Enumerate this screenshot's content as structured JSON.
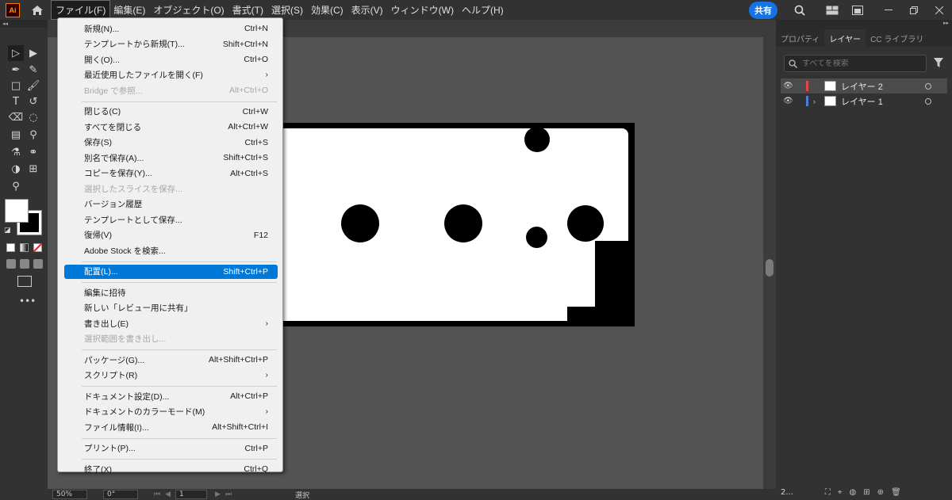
{
  "app": {
    "logo_text": "Ai",
    "menus": [
      "ファイル(F)",
      "編集(E)",
      "オブジェクト(O)",
      "書式(T)",
      "選択(S)",
      "効果(C)",
      "表示(V)",
      "ウィンドウ(W)",
      "ヘルプ(H)"
    ],
    "share_label": "共有"
  },
  "file_menu": {
    "items": [
      {
        "label": "新規(N)...",
        "shortcut": "Ctrl+N"
      },
      {
        "label": "テンプレートから新規(T)...",
        "shortcut": "Shift+Ctrl+N"
      },
      {
        "label": "開く(O)...",
        "shortcut": "Ctrl+O"
      },
      {
        "label": "最近使用したファイルを開く(F)",
        "shortcut": "›"
      },
      {
        "label": "Bridge で参照...",
        "shortcut": "Alt+Ctrl+O"
      },
      {
        "label": "閉じる(C)",
        "shortcut": "Ctrl+W"
      },
      {
        "label": "すべてを閉じる",
        "shortcut": "Alt+Ctrl+W"
      },
      {
        "label": "保存(S)",
        "shortcut": "Ctrl+S"
      },
      {
        "label": "別名で保存(A)...",
        "shortcut": "Shift+Ctrl+S"
      },
      {
        "label": "コピーを保存(Y)...",
        "shortcut": "Alt+Ctrl+S"
      },
      {
        "label": "選択したスライスを保存...",
        "shortcut": ""
      },
      {
        "label": "バージョン履歴",
        "shortcut": ""
      },
      {
        "label": "テンプレートとして保存...",
        "shortcut": ""
      },
      {
        "label": "復帰(V)",
        "shortcut": "F12"
      },
      {
        "label": "Adobe Stock を検索...",
        "shortcut": ""
      },
      {
        "label": "配置(L)...",
        "shortcut": "Shift+Ctrl+P"
      },
      {
        "label": "編集に招待",
        "shortcut": ""
      },
      {
        "label": "新しい「レビュー用に共有」",
        "shortcut": ""
      },
      {
        "label": "書き出し(E)",
        "shortcut": "›"
      },
      {
        "label": "選択範囲を書き出し...",
        "shortcut": ""
      },
      {
        "label": "パッケージ(G)...",
        "shortcut": "Alt+Shift+Ctrl+P"
      },
      {
        "label": "スクリプト(R)",
        "shortcut": "›"
      },
      {
        "label": "ドキュメント設定(D)...",
        "shortcut": "Alt+Ctrl+P"
      },
      {
        "label": "ドキュメントのカラーモード(M)",
        "shortcut": "›"
      },
      {
        "label": "ファイル情報(I)...",
        "shortcut": "Alt+Shift+Ctrl+I"
      },
      {
        "label": "プリント(P)...",
        "shortcut": "Ctrl+P"
      },
      {
        "label": "終了(X)",
        "shortcut": "Ctrl+Q"
      }
    ]
  },
  "panel": {
    "tabs": [
      "プロパティ",
      "レイヤー",
      "CC ライブラリ"
    ],
    "search_placeholder": "すべてを検索",
    "layers": [
      {
        "name": "レイヤー 2",
        "color": "#e0474c"
      },
      {
        "name": "レイヤー 1",
        "color": "#4f7bd8"
      }
    ],
    "layer_count": "2..."
  },
  "status": {
    "zoom": "50%",
    "rotate": "0°",
    "artboard": "1",
    "mode": "選択"
  },
  "colors": {
    "accent": "#0078d7",
    "share": "#1473e6"
  }
}
